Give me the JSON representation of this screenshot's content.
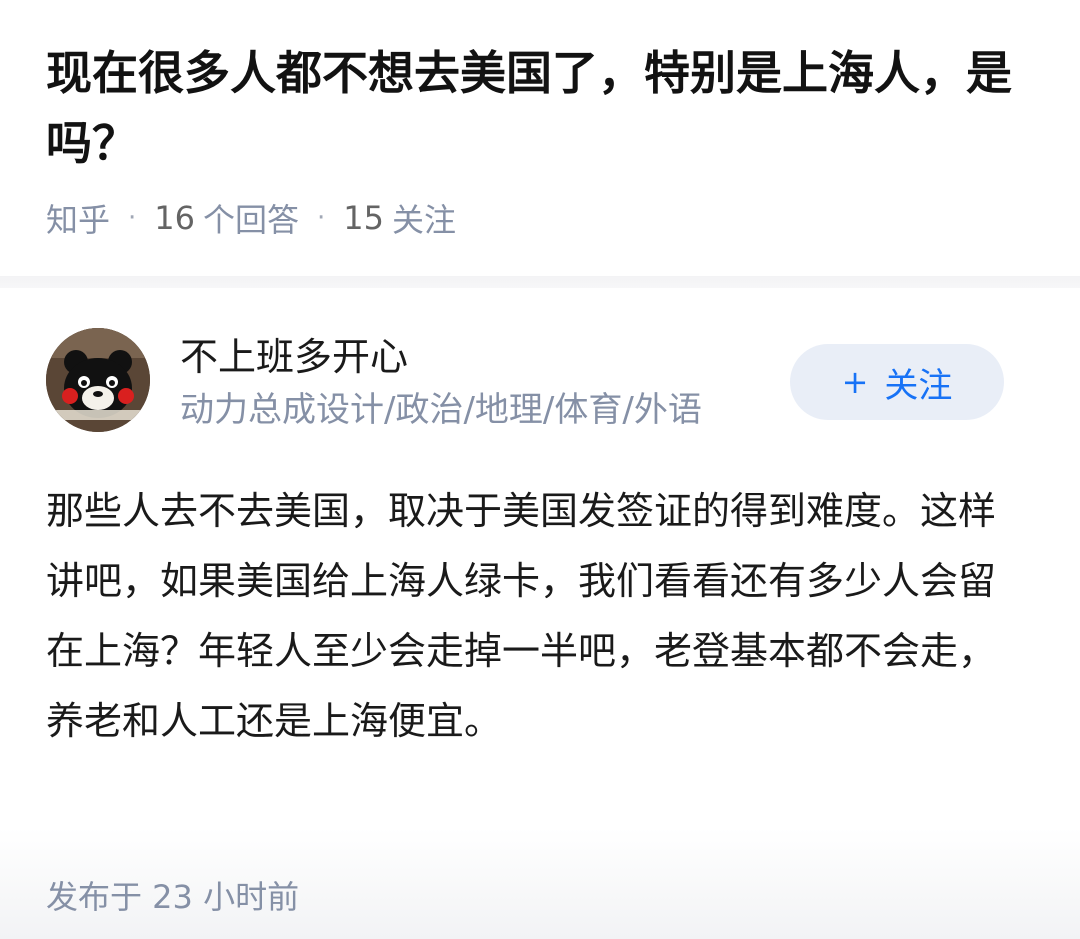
{
  "question": {
    "title": "现在很多人都不想去美国了，特别是上海人，是吗？",
    "source": "知乎",
    "separator": "·",
    "answer_count": "16",
    "answer_label": "个回答",
    "follower_count": "15",
    "follower_label": "关注"
  },
  "answer": {
    "author": {
      "name": "不上班多开心",
      "bio": "动力总成设计/政治/地理/体育/外语",
      "avatar": "kumamon-avatar"
    },
    "follow_button": {
      "icon": "+",
      "label": "关注"
    },
    "content": "那些人去不去美国，取决于美国发签证的得到难度。这样讲吧，如果美国给上海人绿卡，我们看看还有多少人会留在上海？年轻人至少会走掉一半吧，老登基本都不会走，养老和人工还是上海便宜。",
    "published": "发布于  23 小时前"
  },
  "colors": {
    "accent": "#1772f6",
    "meta_text": "#8590a6",
    "button_bg": "#e9eef7"
  }
}
